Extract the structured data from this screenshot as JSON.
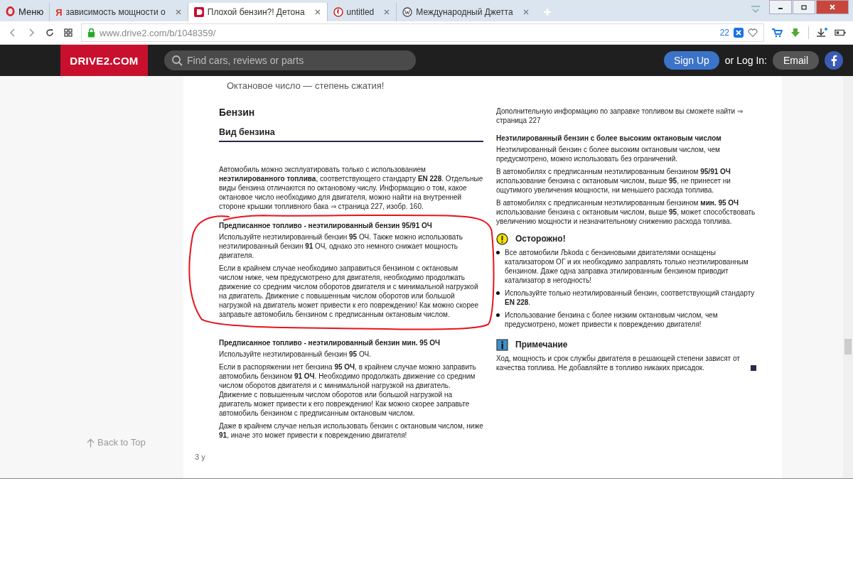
{
  "browser": {
    "menu_label": "Меню",
    "tabs": [
      {
        "label": "зависимость мощности о",
        "selected": false,
        "kind": "yandex",
        "icon_text": "Я"
      },
      {
        "label": "Плохой бензин?! Детона",
        "selected": true,
        "kind": "drive2"
      },
      {
        "label": "untitled",
        "selected": false,
        "kind": "generic"
      },
      {
        "label": "Международный Джетта",
        "selected": false,
        "kind": "vw"
      }
    ],
    "url": "www.drive2.com/b/1048359/",
    "badge": "22"
  },
  "site_header": {
    "logo": "DRIVE2.COM",
    "search": {
      "placeholder": "Find cars, reviews or parts"
    },
    "sign_up": "Sign Up",
    "login_label": "or Log In:",
    "email": "Email"
  },
  "post": {
    "caption": "Октановое число — степень сжатия!",
    "document": {
      "left": [
        {
          "kind": "heading",
          "text": "Бензин"
        },
        {
          "kind": "subheading",
          "text": "Вид бензина"
        },
        {
          "kind": "para",
          "text": "Автомобиль можно эксплуатировать только с использованием **неэтилированного топлива**, соответствующего стандарту **EN 228**. Отдельные виды бензина отличаются по октановому числу. Информацию о том, какое октановое число необходимо для двигателя, можно найти на внутренней стороне крышки топливного бака ⇒ страница 227, изобр. 160."
        },
        {
          "kind": "circled",
          "children": [
            {
              "kind": "title",
              "text": "Предписанное топливо - неэтилированный бензин 95/91 ОЧ"
            },
            {
              "kind": "para",
              "text": "Используйте неэтилированный бензин **95** ОЧ. Также можно использовать неэтилированный бензин **91** ОЧ, однако это немного снижает мощность двигателя."
            },
            {
              "kind": "para",
              "text": "Если в крайнем случае необходимо заправиться бензином с октановым числом ниже, чем предусмотрено для двигателя, необходимо продолжать движение со средним числом оборотов двигателя и с минимальной нагрузкой на двигатель. Движение с повышенным числом оборотов или большой нагрузкой на двигатель может привести к его повреждению! Как можно скорее заправьте автомобиль бензином с предписанным октановым числом."
            }
          ]
        },
        {
          "kind": "title",
          "text": "Предписанное топливо - неэтилированный бензин мин. 95 ОЧ"
        },
        {
          "kind": "para",
          "text": "Используйте неэтилированный бензин **95** ОЧ."
        },
        {
          "kind": "para",
          "text": "Если в распоряжении нет бензина **95 ОЧ**, в крайнем случае можно заправить автомобиль бензином **91 ОЧ**. Необходимо продолжать движение со средним числом оборотов двигателя и с минимальной нагрузкой на двигатель. Движение с повышенным числом оборотов или большой нагрузкой на двигатель может привести к его повреждению! Как можно скорее заправьте автомобиль бензином с предписанным октановым числом."
        },
        {
          "kind": "para",
          "text": "Даже в крайнем случае нельзя использовать бензин с октановым числом, ниже **91**, иначе это может привести к повреждению двигателя!"
        }
      ],
      "right": [
        {
          "kind": "para",
          "text": "Дополнительную информацию по заправке топливом вы сможете найти ⇒ страница 227"
        },
        {
          "kind": "title",
          "text": "Неэтилированный бензин с более высоким октановым числом"
        },
        {
          "kind": "para",
          "text": "Неэтилированный бензин с более высоким октановым числом, чем предусмотрено, можно использовать без ограничений."
        },
        {
          "kind": "para",
          "text": "В автомобилях с предписанным неэтилированным бензином **95/91 ОЧ** использование бензина с октановым числом, выше **95**, не принесет ни ощутимого увеличения мощности, ни меньшего расхода топлива."
        },
        {
          "kind": "para",
          "text": "В автомобилях с предписанным неэтилированным бензином **мин. 95 ОЧ** использование бензина с октановым числом, выше **95**, может способствовать увеличению мощности и незначительному снижению расхода топлива."
        },
        {
          "kind": "warning",
          "text": "Осторожно!"
        },
        {
          "kind": "bullet",
          "text": "Все автомобили Љkoda с бензиновыми двигателями оснащены катализатором ОГ и их необходимо заправлять только неэтилированным бензином. Даже одна заправка этилированным бензином приводит катализатор в негодность!"
        },
        {
          "kind": "bullet",
          "text": "Используйте только неэтилированный бензин, соответствующий стандарту **EN 228**."
        },
        {
          "kind": "bullet",
          "text": "Использование бензина с более низким октановым числом, чем предусмотрено, может привести к повреждению двигателя!"
        },
        {
          "kind": "info",
          "text": "Примечание"
        },
        {
          "kind": "para_end",
          "text": "Ход, мощность и срок службы двигателя в решающей степени зависят от качества топлива. Не добавляйте в топливо никаких присадок."
        }
      ]
    }
  },
  "back_to_top": "Back to Top",
  "footer_count": "3 у"
}
